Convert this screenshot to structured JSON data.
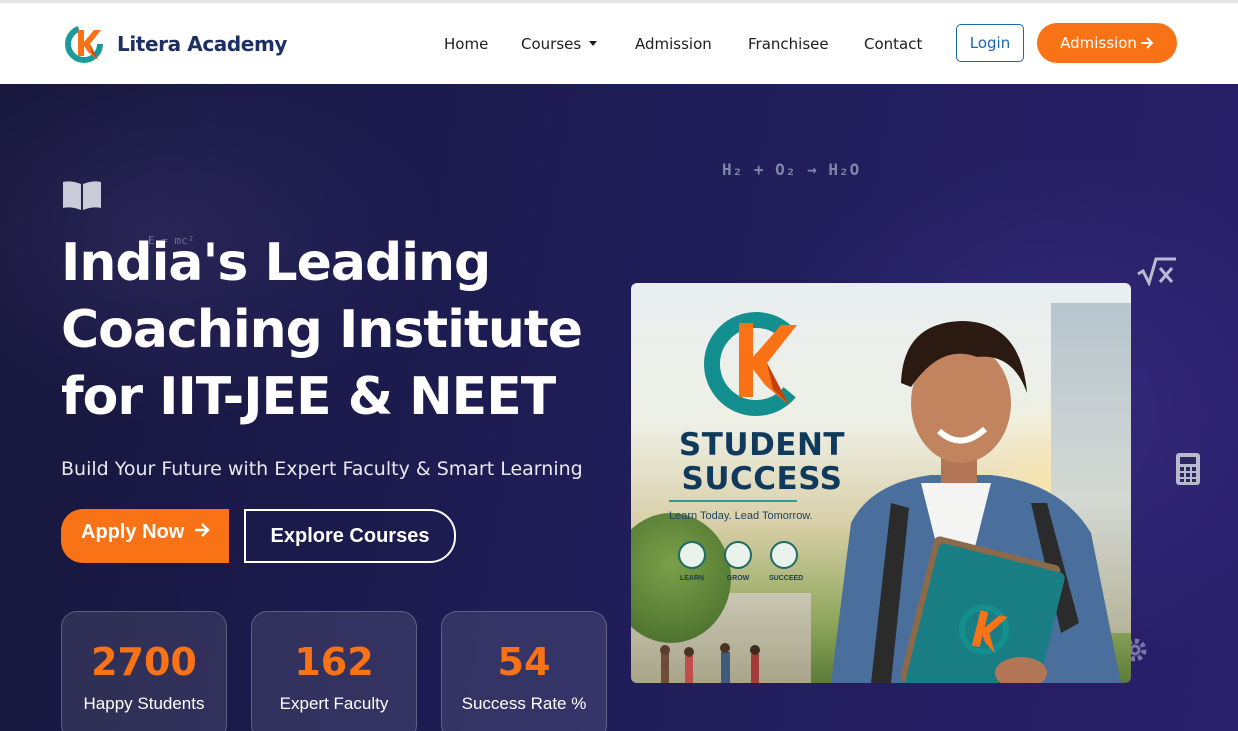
{
  "brand": {
    "name": "Litera Academy",
    "accent": "#f97316",
    "primary": "#1e2f63"
  },
  "nav": {
    "items": [
      {
        "label": "Home"
      },
      {
        "label": "Courses",
        "has_dropdown": true
      },
      {
        "label": "Admission"
      },
      {
        "label": "Franchisee"
      },
      {
        "label": "Contact"
      }
    ],
    "login_label": "Login",
    "admission_label": "Admission",
    "admission_icon": "arrow-right-icon"
  },
  "hero": {
    "formula_top": "H₂ + O₂ → H₂O",
    "formula_small": "E = mc²",
    "title_lines": [
      "India's Leading",
      "Coaching Institute",
      "for IIT-JEE & NEET"
    ],
    "subtitle": "Build Your Future with Expert Faculty & Smart Learning",
    "apply_label": "Apply Now",
    "explore_label": "Explore Courses",
    "decor_icons": [
      "book-icon",
      "square-root-icon",
      "calculator-icon",
      "gear-icon"
    ],
    "stats": [
      {
        "value": "2700",
        "label": "Happy Students"
      },
      {
        "value": "162",
        "label": "Expert Faculty"
      },
      {
        "value": "54",
        "label": "Success Rate %"
      }
    ]
  },
  "promo_image": {
    "title_line1": "STUDENT",
    "title_line2": "SUCCESS",
    "tagline": "Learn Today. Lead Tomorrow.",
    "badges": [
      "LEARN",
      "GROW",
      "SUCCEED"
    ]
  }
}
